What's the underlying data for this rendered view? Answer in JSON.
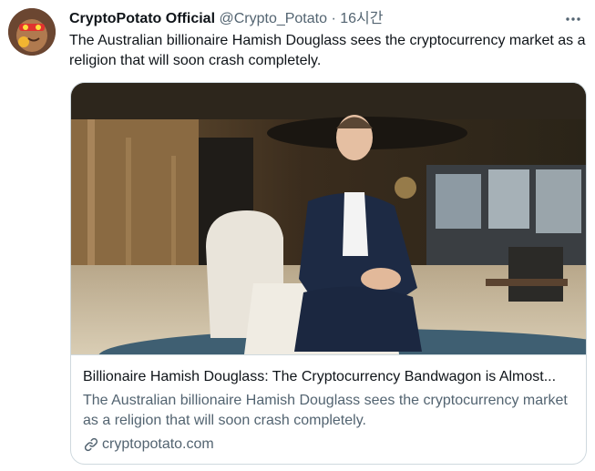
{
  "tweet": {
    "author_name": "CryptoPotato Official",
    "handle": "@Crypto_Potato",
    "separator": "·",
    "time": "16시간",
    "text": "The Australian billionaire Hamish Douglass sees the cryptocurrency market as a religion that will soon crash completely."
  },
  "card": {
    "title": "Billionaire Hamish Douglass: The Cryptocurrency Bandwagon is Almost...",
    "description": "The Australian billionaire Hamish Douglass sees the cryptocurrency market as a religion that will soon crash completely.",
    "domain": "cryptopotato.com"
  },
  "icons": {
    "more": "more-horizontal-icon",
    "link": "link-icon"
  },
  "colors": {
    "text_primary": "#0f1419",
    "text_secondary": "#536471",
    "border": "#cfd9de"
  }
}
